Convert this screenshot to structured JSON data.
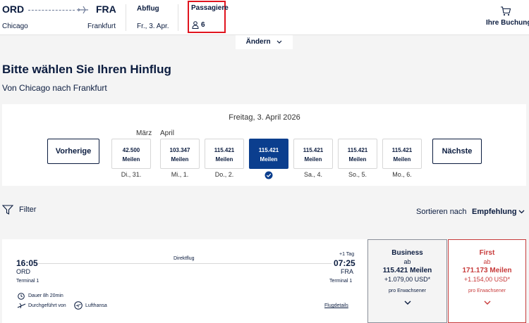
{
  "header": {
    "origin_code": "ORD",
    "origin_city": "Chicago",
    "dest_code": "FRA",
    "dest_city": "Frankfurt",
    "departure_label": "Abflug",
    "departure_value": "Fr., 3. Apr.",
    "passengers_label": "Passagiere",
    "passengers_value": "6",
    "booking_label": "Ihre Buchung",
    "change_label": "Ändern"
  },
  "page": {
    "title": "Bitte wählen Sie Ihren Hinflug",
    "subtitle": "Von Chicago nach Frankfurt"
  },
  "calendar": {
    "selected_date": "Freitag, 3. April 2026",
    "month_prev": "März",
    "month_next": "April",
    "prev_label": "Vorherige",
    "next_label": "Nächste",
    "days": [
      {
        "miles": "42.500",
        "unit": "Meilen",
        "label": "Di., 31."
      },
      {
        "miles": "103.347",
        "unit": "Meilen",
        "label": "Mi., 1."
      },
      {
        "miles": "115.421",
        "unit": "Meilen",
        "label": "Do., 2."
      },
      {
        "miles": "115.421",
        "unit": "Meilen",
        "label": ""
      },
      {
        "miles": "115.421",
        "unit": "Meilen",
        "label": "Sa., 4."
      },
      {
        "miles": "115.421",
        "unit": "Meilen",
        "label": "So., 5."
      },
      {
        "miles": "115.421",
        "unit": "Meilen",
        "label": "Mo., 6."
      }
    ]
  },
  "filter": {
    "label": "Filter",
    "sort_label": "Sortieren nach",
    "sort_value": "Empfehlung"
  },
  "flight": {
    "dep_time": "16:05",
    "dep_airport": "ORD",
    "dep_terminal": "Terminal 1",
    "type": "Direktflug",
    "day_offset": "+1 Tag",
    "arr_time": "07:25",
    "arr_airport": "FRA",
    "arr_terminal": "Terminal 1",
    "duration": "Dauer 8h 20min",
    "operated_by": "Durchgeführt von",
    "airline": "Lufthansa",
    "details_link": "Flugdetails"
  },
  "fares": {
    "business": {
      "title": "Business",
      "from": "ab",
      "miles": "115.421 Meilen",
      "usd": "+1.079,00 USD*",
      "per": "pro Erwachsener"
    },
    "first": {
      "title": "First",
      "from": "ab",
      "miles": "171.173 Meilen",
      "usd": "+1.154,00 USD*",
      "per": "pro Erwachsener"
    }
  },
  "colors": {
    "navy": "#0b1c3f",
    "selected_day": "#0b3e8e",
    "first_red": "#c73a3a",
    "highlight_red": "#e0141e"
  }
}
